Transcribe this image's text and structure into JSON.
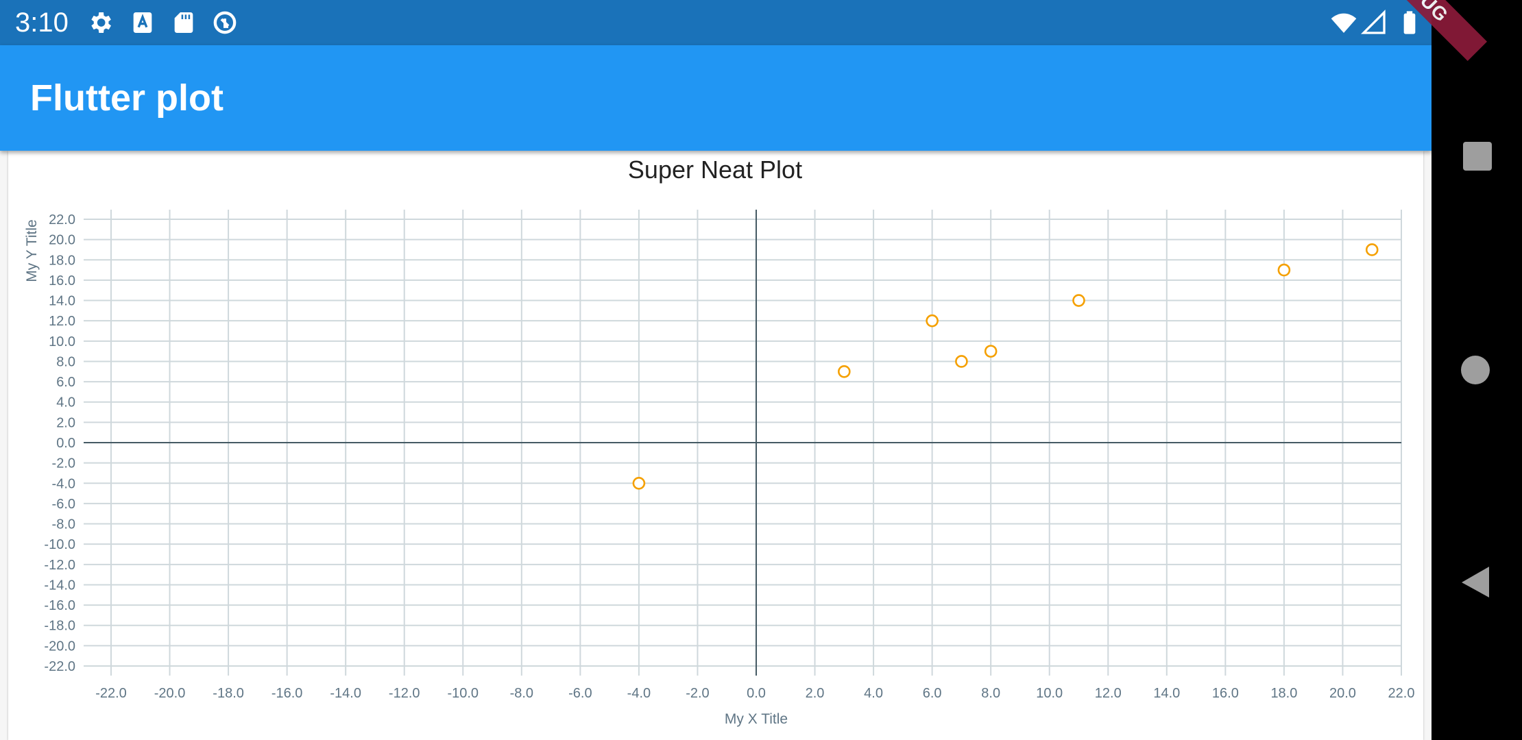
{
  "status_bar": {
    "time": "3:10",
    "left_icons": [
      "gear-icon",
      "font-a-icon",
      "sd-card-icon",
      "sync-circle-icon"
    ],
    "right_icons": [
      "wifi-icon",
      "cell-signal-icon",
      "battery-icon"
    ]
  },
  "app_bar": {
    "title": "Flutter plot",
    "color": "#2196f3"
  },
  "debug_banner": "DEBUG",
  "nav_bar": {
    "icons": [
      "square-recents-icon",
      "circle-home-icon",
      "triangle-back-icon"
    ]
  },
  "chart_data": {
    "type": "scatter",
    "title": "Super Neat Plot",
    "xlabel": "My X Title",
    "ylabel": "My Y Title",
    "xlim": [
      -22,
      22
    ],
    "ylim": [
      -22,
      22
    ],
    "tick_step": 2,
    "grid": true,
    "marker_color": "#f5a000",
    "grid_color": "#cfd8dc",
    "axis_color": "#455a64",
    "x_ticks": [
      "-22.0",
      "-20.0",
      "-18.0",
      "-16.0",
      "-14.0",
      "-12.0",
      "-10.0",
      "-8.0",
      "-6.0",
      "-4.0",
      "-2.0",
      "0.0",
      "2.0",
      "4.0",
      "6.0",
      "8.0",
      "10.0",
      "12.0",
      "14.0",
      "16.0",
      "18.0",
      "20.0",
      "22.0"
    ],
    "y_ticks": [
      "-22.0",
      "-20.0",
      "-18.0",
      "-16.0",
      "-14.0",
      "-12.0",
      "-10.0",
      "-8.0",
      "-6.0",
      "-4.0",
      "-2.0",
      "0.0",
      "2.0",
      "4.0",
      "6.0",
      "8.0",
      "10.0",
      "12.0",
      "14.0",
      "16.0",
      "18.0",
      "20.0",
      "22.0"
    ],
    "points": [
      {
        "x": -4,
        "y": -4
      },
      {
        "x": 3,
        "y": 7
      },
      {
        "x": 6,
        "y": 12
      },
      {
        "x": 7,
        "y": 8
      },
      {
        "x": 8,
        "y": 9
      },
      {
        "x": 11,
        "y": 14
      },
      {
        "x": 18,
        "y": 17
      },
      {
        "x": 21,
        "y": 19
      }
    ]
  }
}
